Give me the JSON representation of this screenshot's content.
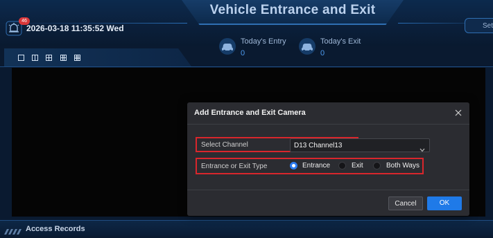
{
  "header": {
    "title": "Vehicle Entrance and Exit",
    "datetime": "2026-03-18 11:35:52 Wed",
    "alarm_count": "46",
    "settings_tab_label": "Set"
  },
  "stats": {
    "entry_label": "Today's Entry",
    "entry_value": "0",
    "exit_label": "Today's Exit",
    "exit_value": "0"
  },
  "layout_buttons": [
    {
      "name": "layout-1-icon"
    },
    {
      "name": "layout-2-icon"
    },
    {
      "name": "layout-4-icon"
    },
    {
      "name": "layout-6-icon"
    },
    {
      "name": "layout-9-icon"
    }
  ],
  "bottom": {
    "title": "Access Records"
  },
  "dialog": {
    "title": "Add Entrance and Exit Camera",
    "channel_label": "Select Channel",
    "channel_value": "D13 Channel13",
    "type_label": "Entrance or Exit Type",
    "options": [
      {
        "label": "Entrance",
        "checked": true
      },
      {
        "label": "Exit",
        "checked": false
      },
      {
        "label": "Both Ways",
        "checked": false
      }
    ],
    "cancel_label": "Cancel",
    "ok_label": "OK"
  },
  "colors": {
    "accent": "#1f7ae8",
    "highlight_outline": "#d9262c",
    "badge": "#d8373a"
  }
}
